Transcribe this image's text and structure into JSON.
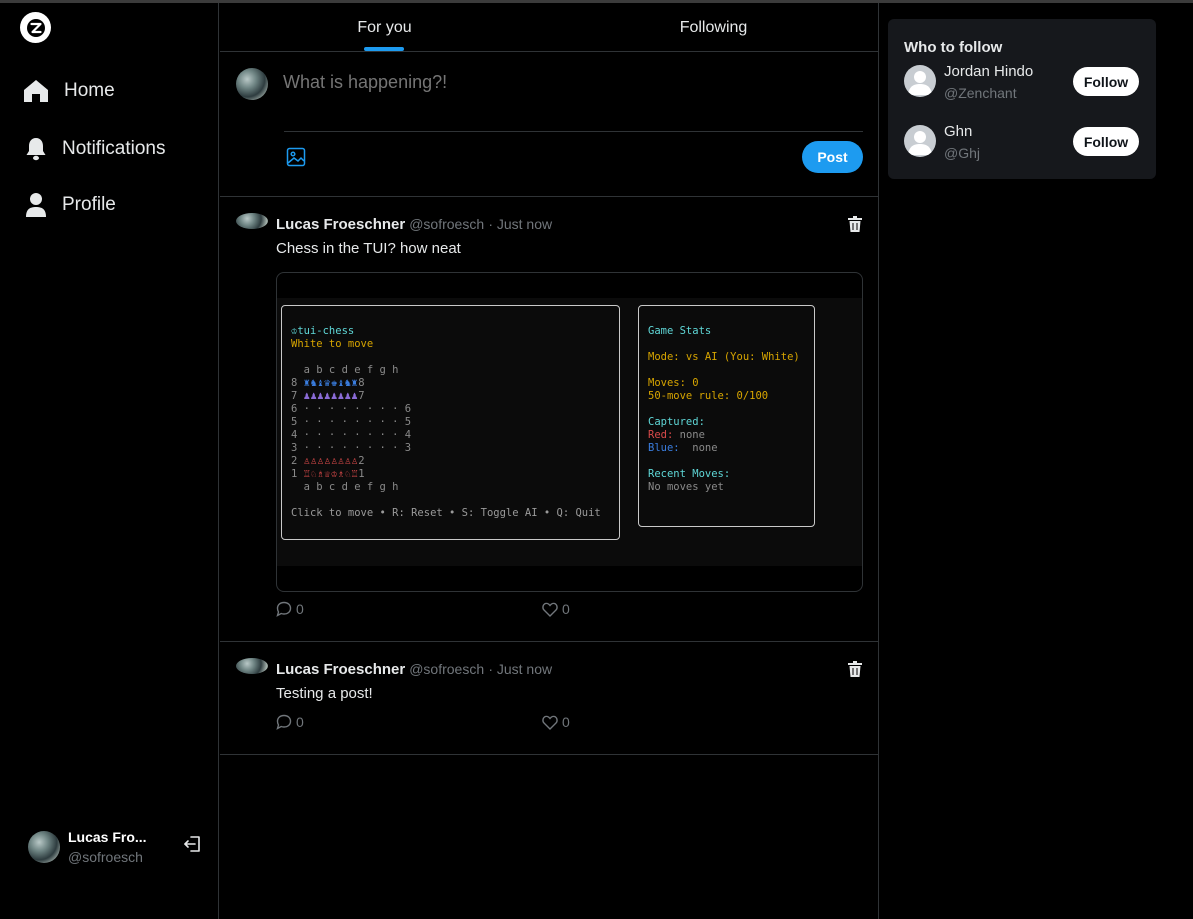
{
  "sidebar": {
    "nav": [
      {
        "label": "Home",
        "icon": "home-icon"
      },
      {
        "label": "Notifications",
        "icon": "bell-icon"
      },
      {
        "label": "Profile",
        "icon": "user-icon"
      }
    ],
    "account": {
      "name": "Lucas Fro...",
      "handle": "@sofroesch"
    }
  },
  "tabs": [
    {
      "label": "For you",
      "active": true
    },
    {
      "label": "Following",
      "active": false
    }
  ],
  "composer": {
    "placeholder": "What is happening?!",
    "post_label": "Post"
  },
  "posts": [
    {
      "author": "Lucas Froeschner",
      "handle": "@sofroesch",
      "time": "· Just now",
      "text": "Chess in the TUI? how neat",
      "replies": "0",
      "likes": "0",
      "image": {
        "left_pane": {
          "title": "♔tui-chess",
          "status": "White to move",
          "files": "  a b c d e f g h",
          "rank8_num": "8 ",
          "rank8_pieces": "♜♞♝♛♚♝♞♜",
          "rank8_end": "8",
          "rank7_num": "7 ",
          "rank7_pieces": "♟♟♟♟♟♟♟♟",
          "rank7_end": "7",
          "rank6": "6 · · · · · · · · 6",
          "rank5": "5 · · · · · · · · 5",
          "rank4": "4 · · · · · · · · 4",
          "rank3": "3 · · · · · · · · 3",
          "rank2_num": "2 ",
          "rank2_pieces": "♙♙♙♙♙♙♙♙",
          "rank2_end": "2",
          "rank1_num": "1 ",
          "rank1_pieces": "♖♘♗♕♔♗♘♖",
          "rank1_end": "1",
          "files_bottom": "  a b c d e f g h",
          "help": "Click to move • R: Reset • S: Toggle AI • Q: Quit"
        },
        "right_pane": {
          "title": "Game Stats",
          "mode": "Mode: vs AI (You: White)",
          "moves": "Moves: 0",
          "fifty": "50-move rule: 0/100",
          "captured": "Captured:",
          "red_label": "Red:",
          "red_value": " none",
          "blue_label": "Blue:",
          "blue_value": "  none",
          "recent": "Recent Moves:",
          "recent_value": "No moves yet"
        }
      }
    },
    {
      "author": "Lucas Froeschner",
      "handle": "@sofroesch",
      "time": "· Just now",
      "text": "Testing a post!",
      "replies": "0",
      "likes": "0"
    }
  ],
  "who_to_follow": {
    "title": "Who to follow",
    "suggestions": [
      {
        "name": "Jordan Hindo",
        "handle": "@Zenchant",
        "button": "Follow"
      },
      {
        "name": "Ghn",
        "handle": "@Ghj",
        "button": "Follow"
      }
    ]
  },
  "colors": {
    "accent": "#1d9bf0",
    "background": "#000000",
    "border": "#2f3336",
    "muted": "#71767b"
  }
}
